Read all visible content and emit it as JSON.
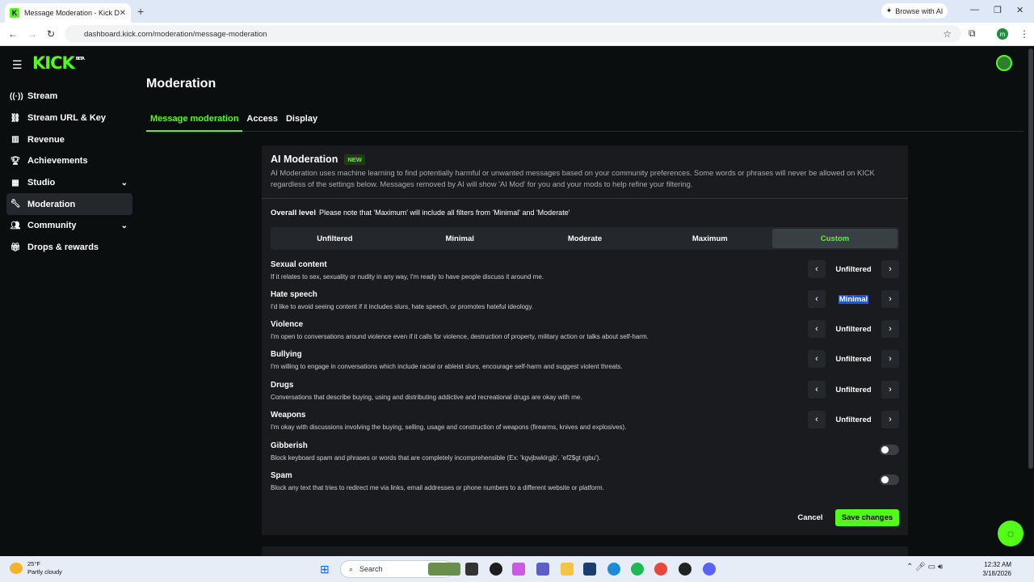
{
  "browser": {
    "tab_title": "Message Moderation - Kick Da",
    "url": "dashboard.kick.com/moderation/message-moderation",
    "browse_ai": "Browse with AI",
    "profile_initial": "m"
  },
  "brand": {
    "logo": "KICK",
    "logo_sup": "BETA",
    "accent": "#53fc18"
  },
  "sidebar": {
    "items": [
      {
        "label": "Stream",
        "icon": "broadcast-icon"
      },
      {
        "label": "Stream URL & Key",
        "icon": "link-icon"
      },
      {
        "label": "Revenue",
        "icon": "chart-icon"
      },
      {
        "label": "Achievements",
        "icon": "trophy-icon"
      },
      {
        "label": "Studio",
        "icon": "studio-icon"
      },
      {
        "label": "Moderation",
        "icon": "wrench-icon"
      },
      {
        "label": "Community",
        "icon": "users-icon"
      },
      {
        "label": "Drops & rewards",
        "icon": "gift-icon"
      }
    ]
  },
  "page": {
    "title": "Moderation"
  },
  "tabs": [
    "Message moderation",
    "Access",
    "Display"
  ],
  "ai_moderation": {
    "title": "AI Moderation",
    "badge": "NEW",
    "description": "AI Moderation uses machine learning to find potentially harmful or unwanted messages based on your community preferences. Some words or phrases will never be allowed on KICK regardless of the settings below. Messages removed by AI will show 'AI Mod' for you and your mods to help refine your filtering.",
    "overall_label": "Overall level",
    "overall_note": "Please note that 'Maximum' will include all filters from 'Minimal' and 'Moderate'",
    "levels": [
      "Unfiltered",
      "Minimal",
      "Moderate",
      "Maximum",
      "Custom"
    ],
    "selected_level": "Custom",
    "categories": [
      {
        "title": "Sexual content",
        "desc": "If it relates to sex, sexuality or nudity in any way, I'm ready to have people discuss it around me.",
        "value": "Unfiltered"
      },
      {
        "title": "Hate speech",
        "desc": "I'd like to avoid seeing content if it includes slurs, hate speech, or promotes hateful ideology.",
        "value": "Minimal"
      },
      {
        "title": "Violence",
        "desc": "I'm open to conversations around violence even if it calls for violence, destruction of property, military action or talks about self-harm.",
        "value": "Unfiltered"
      },
      {
        "title": "Bullying",
        "desc": "I'm willing to engage in conversations which include racial or ableist slurs, encourage self-harm and suggest violent threats.",
        "value": "Unfiltered"
      },
      {
        "title": "Drugs",
        "desc": "Conversations that describe buying, using and distributing addictive and recreational drugs are okay with me.",
        "value": "Unfiltered"
      },
      {
        "title": "Weapons",
        "desc": "I'm okay with discussions involving the buying, selling, usage and construction of weapons (firearms, knives and explosives).",
        "value": "Unfiltered"
      }
    ],
    "toggles": [
      {
        "title": "Gibberish",
        "desc": "Block keyboard spam and phrases or words that are completely incomprehensible (Ex: 'kgvjbwklrgjb', 'ef2$gt rgbu').",
        "on": false
      },
      {
        "title": "Spam",
        "desc": "Block any text that tries to redirect me via links, email addresses or phone numbers to a different website or platform.",
        "on": false
      }
    ],
    "cancel": "Cancel",
    "save": "Save changes"
  },
  "taskbar": {
    "temp": "25°F",
    "weather": "Partly cloudy",
    "search": "Search",
    "time": "12:32 AM",
    "date": "3/18/2026"
  }
}
